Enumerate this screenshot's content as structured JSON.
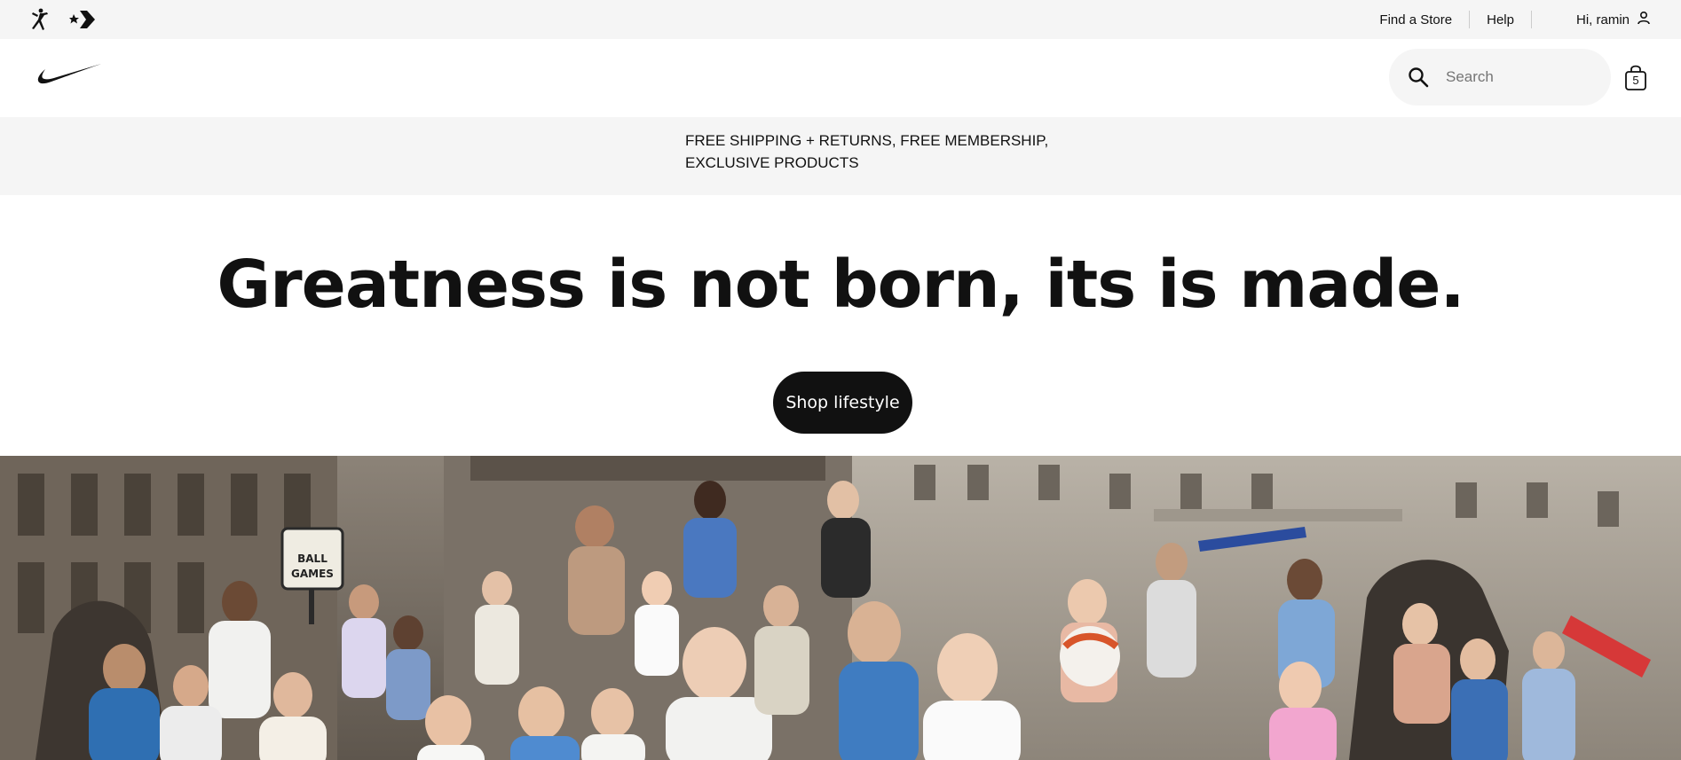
{
  "utility_bar": {
    "brands": [
      {
        "name": "jordan-logo-icon"
      },
      {
        "name": "converse-logo-icon"
      }
    ],
    "links": [
      "Find a Store",
      "Help"
    ],
    "user_greeting": "Hi, ramin",
    "user_icon": "user-icon"
  },
  "header": {
    "logo": "nike-swoosh-logo",
    "search": {
      "placeholder": "Search",
      "value": "",
      "icon": "search-icon"
    },
    "bag": {
      "icon": "shopping-bag-icon",
      "count": "5"
    }
  },
  "promo": {
    "line1": "FREE SHIPPING + RETURNS, FREE MEMBERSHIP,",
    "line2": "EXCLUSIVE PRODUCTS"
  },
  "hero": {
    "title": "Greatness is not born, its is made.",
    "cta_label": "Shop lifestyle",
    "sign_line1": "BALL",
    "sign_line2": "GAMES"
  },
  "colors": {
    "background": "#ffffff",
    "utility_bg": "#f5f5f5",
    "text": "#111111",
    "cta_bg": "#111111",
    "cta_text": "#ffffff"
  }
}
